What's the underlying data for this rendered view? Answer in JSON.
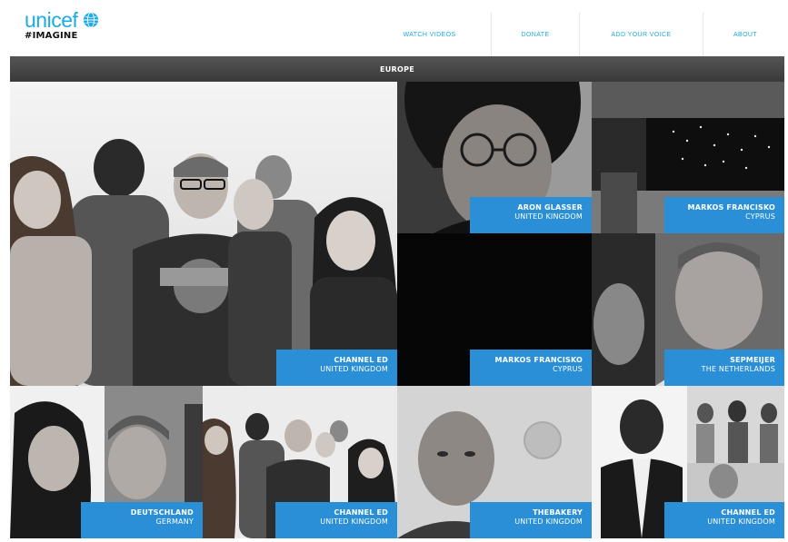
{
  "header": {
    "logo_word": "unicef",
    "logo_tag": "#IMAGINE",
    "nav": [
      {
        "label": "WATCH VIDEOS"
      },
      {
        "label": "DONATE"
      },
      {
        "label": "ADD YOUR VOICE"
      },
      {
        "label": "ABOUT"
      }
    ]
  },
  "region": {
    "title": "EUROPE"
  },
  "tiles": [
    {
      "name": "CHANNEL ED",
      "country": "UNITED KINGDOM"
    },
    {
      "name": "ARON GLASSER",
      "country": "UNITED KINGDOM"
    },
    {
      "name": "MARKOS FRANCISKO",
      "country": "CYPRUS"
    },
    {
      "name": "MARKOS FRANCISKO",
      "country": "CYPRUS"
    },
    {
      "name": "SEPMEIJER",
      "country": "THE NETHERLANDS"
    },
    {
      "name": "DEUTSCHLAND",
      "country": "GERMANY"
    },
    {
      "name": "CHANNEL ED",
      "country": "UNITED KINGDOM"
    },
    {
      "name": "THEBAKERY",
      "country": "UNITED KINGDOM"
    },
    {
      "name": "CHANNEL ED",
      "country": "UNITED KINGDOM"
    }
  ],
  "colors": {
    "brand": "#1cabe2",
    "caption_bg": "#2a8fd6",
    "region_bar": "#4a4a4a"
  }
}
